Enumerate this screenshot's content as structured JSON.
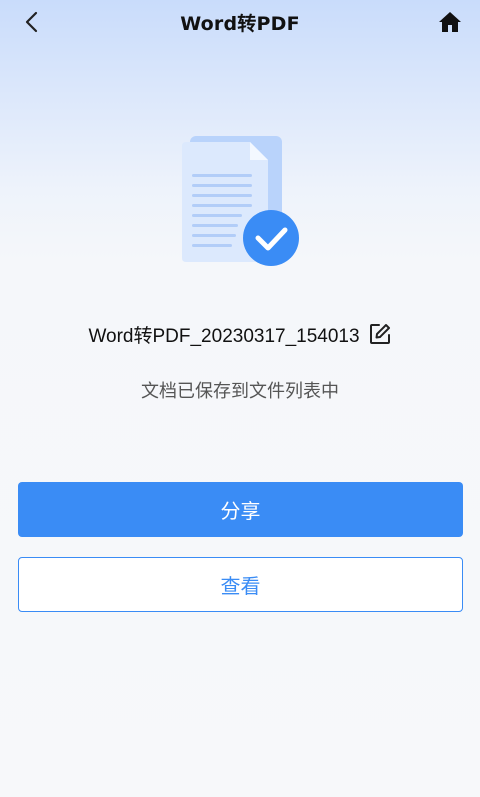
{
  "header": {
    "title": "Word转PDF",
    "back_icon": "chevron-left-icon",
    "home_icon": "home-icon"
  },
  "result": {
    "illustration": "document-check-icon",
    "filename": "Word转PDF_20230317_154013",
    "edit_icon": "edit-icon",
    "message": "文档已保存到文件列表中"
  },
  "actions": {
    "share_label": "分享",
    "view_label": "查看"
  },
  "colors": {
    "accent": "#3a8cf5",
    "text_primary": "#111111",
    "text_secondary": "#555555"
  }
}
